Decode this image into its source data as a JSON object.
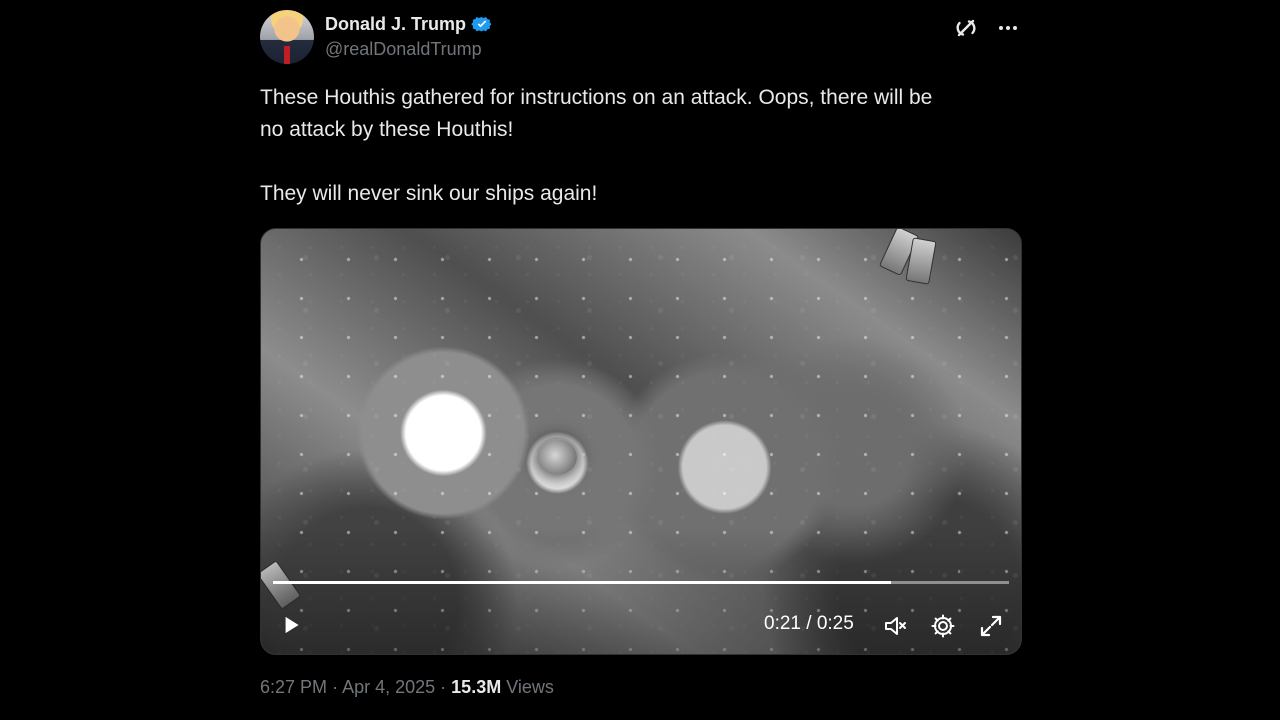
{
  "author": {
    "display_name": "Donald J. Trump",
    "handle": "@realDonaldTrump",
    "verified_icon": "verified-badge-icon"
  },
  "actions": {
    "grok_icon": "grok-icon",
    "more_icon": "more-icon"
  },
  "post": {
    "line_1": "These Houthis gathered for instructions on an attack. Oops, there will be",
    "line_2": "no attack by these Houthis!",
    "line_3": "They will never sink our ships again!"
  },
  "video": {
    "time": "0:21 / 0:25",
    "progress": 0.84,
    "play_icon": "play-icon",
    "mute_icon": "mute-icon",
    "settings_icon": "settings-icon",
    "fullscreen_icon": "fullscreen-icon"
  },
  "meta": {
    "time": "6:27 PM",
    "date": "Apr 4, 2025",
    "views_count": "15.3M",
    "views_label": "Views"
  },
  "colors": {
    "background": "#000000",
    "text": "#e7e9ea",
    "secondary_text": "#71767b",
    "verified": "#1d9bf0"
  }
}
